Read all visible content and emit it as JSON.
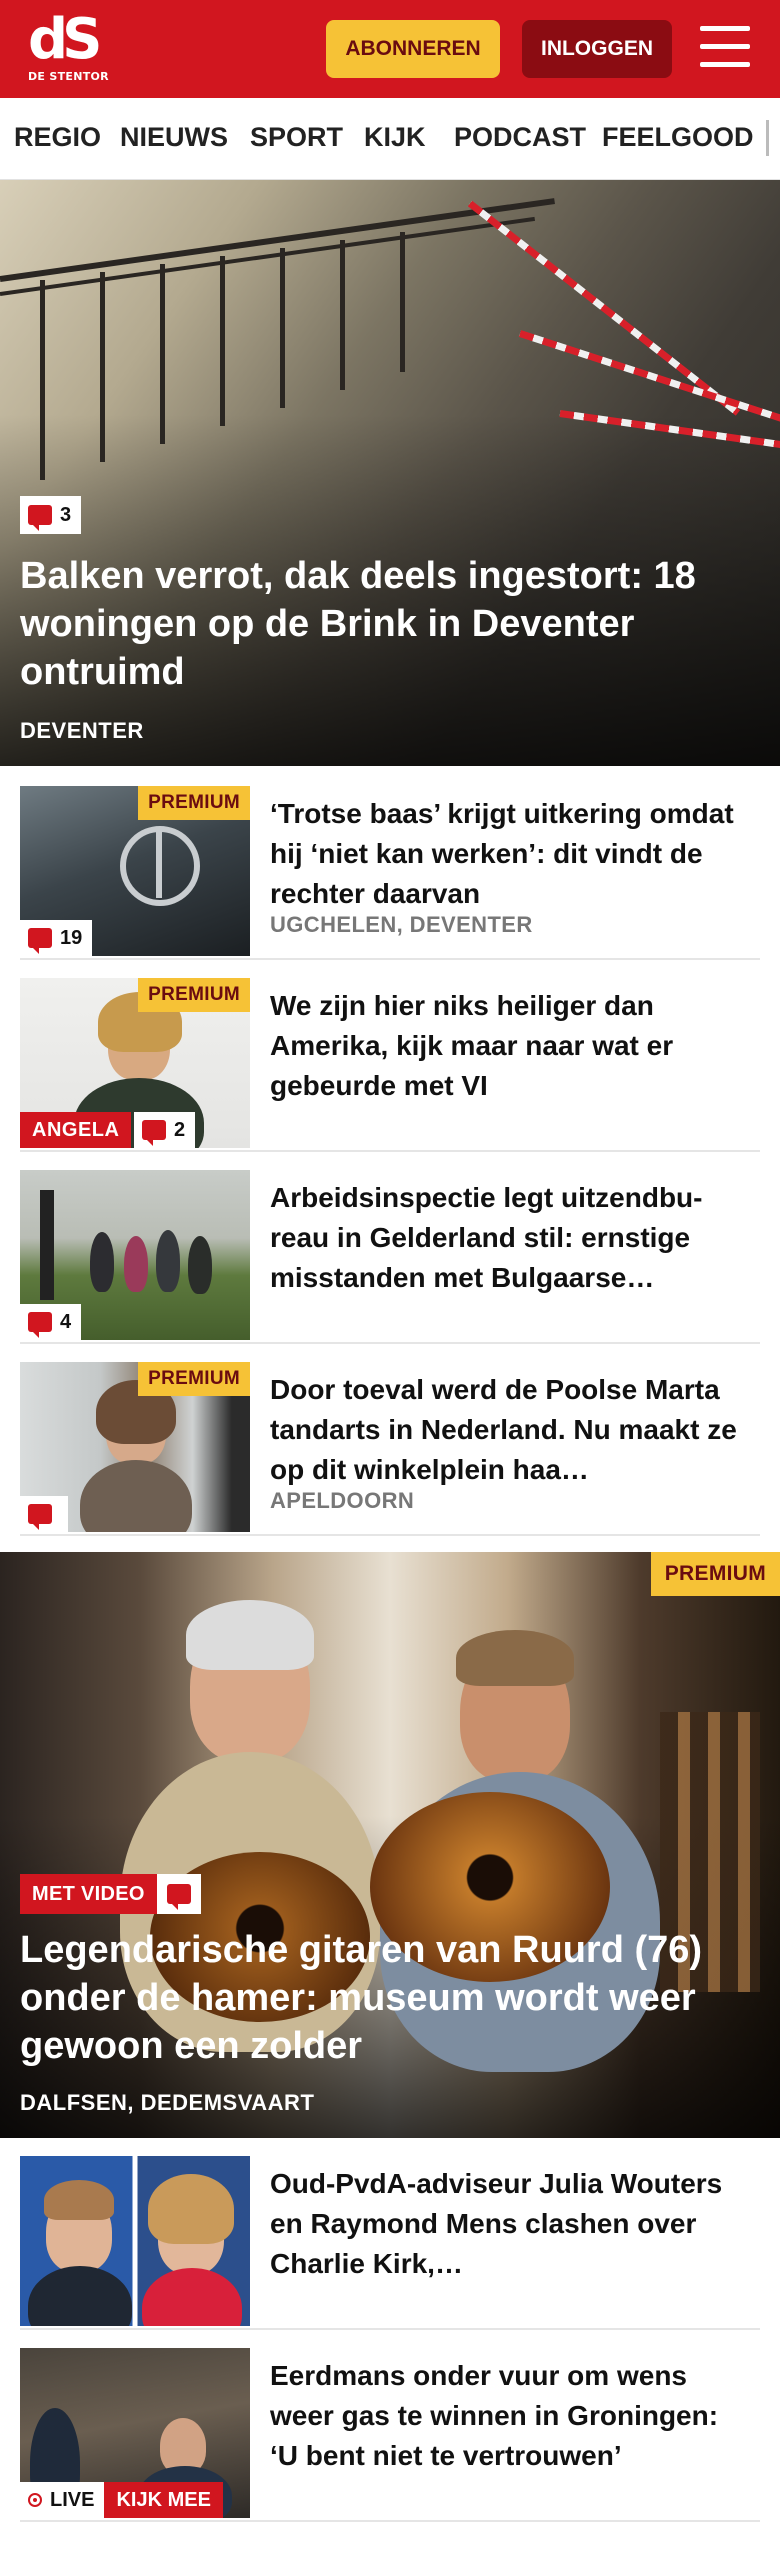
{
  "header": {
    "logo_mark": "dS",
    "logo_sub": "DE STENTOR",
    "subscribe_label": "ABONNEREN",
    "login_label": "INLOGGEN"
  },
  "nav": {
    "items": [
      "REGIO",
      "NIEUWS",
      "SPORT",
      "KIJK",
      "PODCAST",
      "FEELGOOD"
    ]
  },
  "hero": {
    "comment_count": "3",
    "title": "Balken verrot, dak deels ingestort: 18 woningen op de Brink in Deventer ontruimd",
    "location": "DEVENTER"
  },
  "articles": [
    {
      "title": "‘Trotse baas’ krijgt uitkering omdat hij ‘niet kan werken’: dit vindt de rechter daarvan",
      "location": "UGCHELEN, DEVENTER",
      "premium": "PREMIUM",
      "comment_count": "19"
    },
    {
      "title": "We zijn hier niks heiliger dan Amerika, kijk maar naar wat er gebeurde met VI",
      "location": "",
      "premium": "PREMIUM",
      "author_tag": "ANGELA",
      "comment_count": "2"
    },
    {
      "title": "Arbeidsinspectie legt uitzendbu­reau in Gelderland stil: ernstige misstanden met Bulgaarse…",
      "location": "",
      "comment_count": "4"
    },
    {
      "title": "Door toeval werd de Poolse Marta tandarts in Nederland. Nu maakt ze op dit winkelplein haa…",
      "location": "APELDOORN",
      "premium": "PREMIUM",
      "comment_count": ""
    }
  ],
  "hero2": {
    "premium": "PREMIUM",
    "video_label": "MET VIDEO",
    "title": "Legendarische gitaren van Ruurd (76) onder de hamer: museum wordt weer gewoon een zolder",
    "location": "DALFSEN, DEDEMSVAART"
  },
  "articles2": [
    {
      "title": "Oud-PvdA-adviseur Julia Wouters en Raymond Mens clashen over Charlie Kirk,…",
      "location": ""
    },
    {
      "title": "Eerdmans onder vuur om wens weer gas te winnen in Groningen: ‘U bent niet te vertrouwen’",
      "location": "",
      "live_label": "LIVE",
      "watch_label": "KIJK MEE"
    }
  ],
  "colors": {
    "brand_red": "#d1161f",
    "premium_yellow": "#f6c236",
    "login_dark_red": "#8b0c12"
  }
}
